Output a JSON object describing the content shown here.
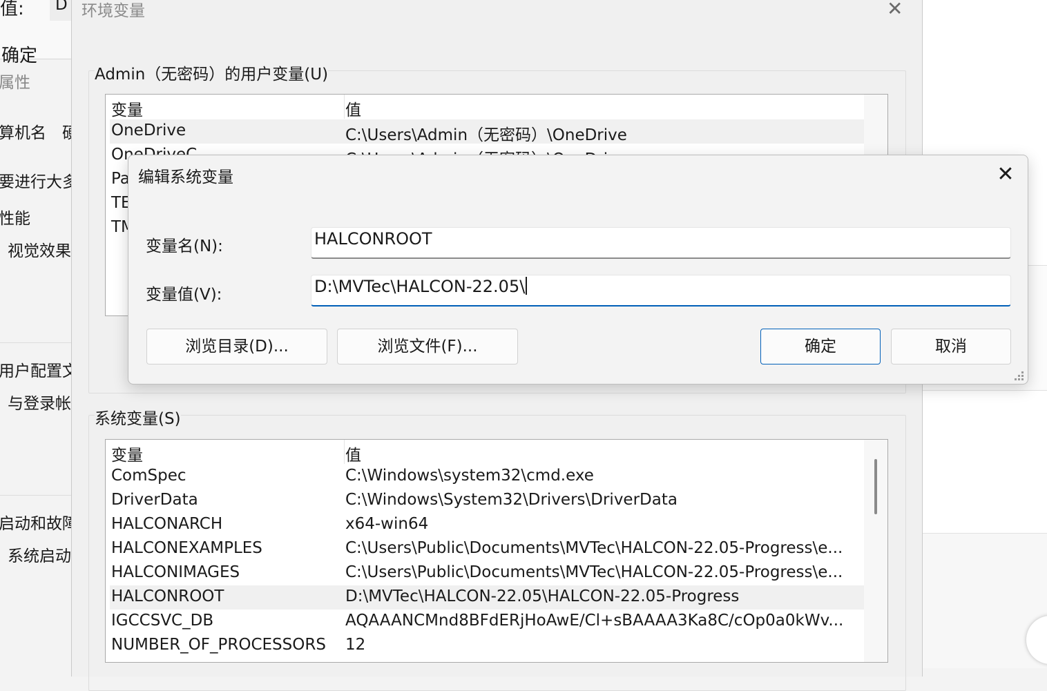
{
  "background_window": {
    "fragments": [
      "值:",
      "D",
      "确定",
      "属性",
      "算机名",
      "硬",
      "要进行大多",
      "性能",
      "视觉效果",
      "用户配置文",
      "与登录帐",
      "启动和故障",
      "系统启动"
    ]
  },
  "env_window": {
    "title": "环境变量",
    "close_glyph": "✕",
    "user_group_label": "Admin（无密码）的用户变量(U)",
    "user_vars": {
      "headers": [
        "变量",
        "值"
      ],
      "rows": [
        {
          "name": "OneDrive",
          "value": "C:\\Users\\Admin（无密码）\\OneDrive"
        },
        {
          "name": "OneDriveC",
          "value": "C:\\Users\\Admin（无密码）\\OneDrive"
        },
        {
          "name": "Pa",
          "value": ""
        },
        {
          "name": "TE",
          "value": ""
        },
        {
          "name": "TM",
          "value": ""
        }
      ]
    },
    "system_group_label": "系统变量(S)",
    "system_vars": {
      "headers": [
        "变量",
        "值"
      ],
      "rows": [
        {
          "name": "ComSpec",
          "value": "C:\\Windows\\system32\\cmd.exe"
        },
        {
          "name": "DriverData",
          "value": "C:\\Windows\\System32\\Drivers\\DriverData"
        },
        {
          "name": "HALCONARCH",
          "value": "x64-win64"
        },
        {
          "name": "HALCONEXAMPLES",
          "value": "C:\\Users\\Public\\Documents\\MVTec\\HALCON-22.05-Progress\\e..."
        },
        {
          "name": "HALCONIMAGES",
          "value": "C:\\Users\\Public\\Documents\\MVTec\\HALCON-22.05-Progress\\e..."
        },
        {
          "name": "HALCONROOT",
          "value": "D:\\MVTec\\HALCON-22.05\\HALCON-22.05-Progress"
        },
        {
          "name": "IGCCSVC_DB",
          "value": "AQAAANCMnd8BFdERjHoAwE/Cl+sBAAAA3Ka8C/cOp0a0kWv..."
        },
        {
          "name": "NUMBER_OF_PROCESSORS",
          "value": "12"
        }
      ]
    }
  },
  "edit_dialog": {
    "title": "编辑系统变量",
    "close_glyph": "✕",
    "name_label": "变量名(N):",
    "name_value": "HALCONROOT",
    "value_label": "变量值(V):",
    "value_value": "D:\\MVTec\\HALCON-22.05\\",
    "browse_dir_label": "浏览目录(D)...",
    "browse_file_label": "浏览文件(F)...",
    "ok_label": "确定",
    "cancel_label": "取消"
  }
}
